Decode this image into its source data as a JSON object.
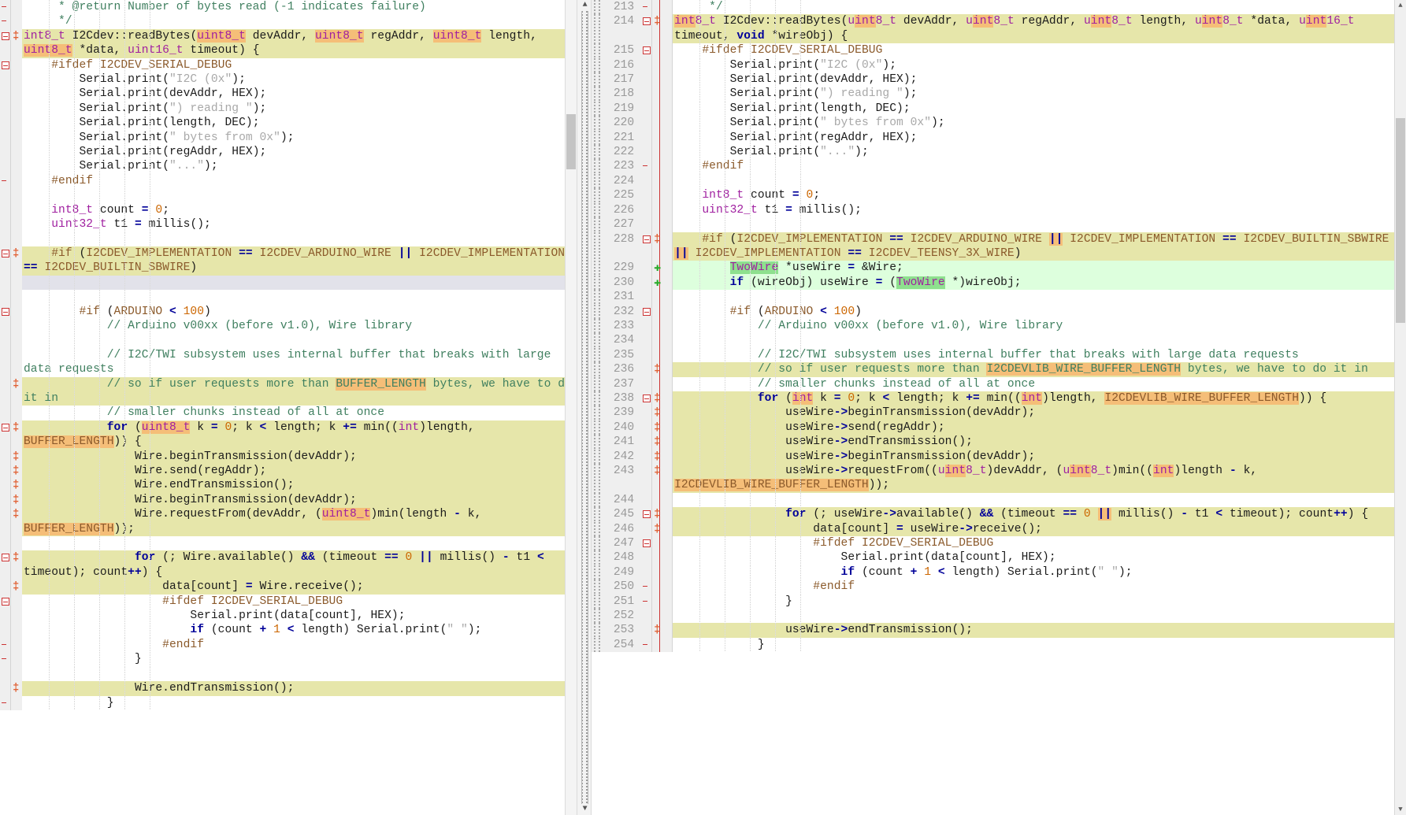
{
  "app": {
    "kind": "side-by-side-source-diff-viewer",
    "colors": {
      "changed_line_bg": "#e6e6aa",
      "added_line_bg": "#ddffdd",
      "inline_change_hl": "#f5be78",
      "inline_add_hl": "#8ee08e",
      "gap_fill_bg": "#e2e2ea",
      "gutter_bg": "#efefef",
      "change_marker": "#e05a2b",
      "add_marker": "#2aaa2a",
      "fold_marker": "#cc3333",
      "linenum_text": "#999999",
      "comment": "#3f7f5f",
      "keyword": "#000099",
      "type": "#a020a0",
      "string": "#a8a8a8",
      "number": "#cc6600",
      "preprocessor": "#8b5a2b"
    }
  },
  "left_pane": {
    "name": "original-version",
    "has_vertical_scrollbar": true,
    "lines": [
      {
        "id": "L000",
        "state": "none",
        "marker": "",
        "fold": "end",
        "text": "     * @return Number of bytes read (-1 indicates failure)"
      },
      {
        "id": "L001",
        "state": "none",
        "marker": "",
        "fold": "end",
        "text": "     */"
      },
      {
        "id": "L002",
        "state": "changed",
        "marker": "change",
        "fold": "start",
        "text": "int8_t I2Cdev::readBytes(uint8_t devAddr, uint8_t regAddr, uint8_t length, uint8_t *data, uint16_t timeout) {"
      },
      {
        "id": "L003",
        "state": "none",
        "marker": "",
        "fold": "start",
        "text": "    #ifdef I2CDEV_SERIAL_DEBUG"
      },
      {
        "id": "L004",
        "state": "none",
        "marker": "",
        "fold": "",
        "text": "        Serial.print(\"I2C (0x\");"
      },
      {
        "id": "L005",
        "state": "none",
        "marker": "",
        "fold": "",
        "text": "        Serial.print(devAddr, HEX);"
      },
      {
        "id": "L006",
        "state": "none",
        "marker": "",
        "fold": "",
        "text": "        Serial.print(\") reading \");"
      },
      {
        "id": "L007",
        "state": "none",
        "marker": "",
        "fold": "",
        "text": "        Serial.print(length, DEC);"
      },
      {
        "id": "L008",
        "state": "none",
        "marker": "",
        "fold": "",
        "text": "        Serial.print(\" bytes from 0x\");"
      },
      {
        "id": "L009",
        "state": "none",
        "marker": "",
        "fold": "",
        "text": "        Serial.print(regAddr, HEX);"
      },
      {
        "id": "L010",
        "state": "none",
        "marker": "",
        "fold": "",
        "text": "        Serial.print(\"...\");"
      },
      {
        "id": "L011",
        "state": "none",
        "marker": "",
        "fold": "end",
        "text": "    #endif"
      },
      {
        "id": "L012",
        "state": "none",
        "marker": "",
        "fold": "",
        "text": ""
      },
      {
        "id": "L013",
        "state": "none",
        "marker": "",
        "fold": "",
        "text": "    int8_t count = 0;"
      },
      {
        "id": "L014",
        "state": "none",
        "marker": "",
        "fold": "",
        "text": "    uint32_t t1 = millis();"
      },
      {
        "id": "L015",
        "state": "none",
        "marker": "",
        "fold": "",
        "text": ""
      },
      {
        "id": "L016",
        "state": "changed",
        "marker": "change",
        "fold": "start",
        "text": "    #if (I2CDEV_IMPLEMENTATION == I2CDEV_ARDUINO_WIRE || I2CDEV_IMPLEMENTATION == I2CDEV_BUILTIN_SBWIRE)"
      },
      {
        "id": "L017",
        "state": "gapfill",
        "marker": "",
        "fold": "",
        "text": ""
      },
      {
        "id": "L018",
        "state": "none",
        "marker": "",
        "fold": "",
        "text": ""
      },
      {
        "id": "L019",
        "state": "none",
        "marker": "",
        "fold": "start",
        "text": "        #if (ARDUINO < 100)"
      },
      {
        "id": "L020",
        "state": "none",
        "marker": "",
        "fold": "",
        "text": "            // Arduino v00xx (before v1.0), Wire library"
      },
      {
        "id": "L021",
        "state": "none",
        "marker": "",
        "fold": "",
        "text": ""
      },
      {
        "id": "L022",
        "state": "none",
        "marker": "",
        "fold": "",
        "text": "            // I2C/TWI subsystem uses internal buffer that breaks with large data requests"
      },
      {
        "id": "L023",
        "state": "changed",
        "marker": "change",
        "fold": "",
        "text": "            // so if user requests more than BUFFER_LENGTH bytes, we have to do it in"
      },
      {
        "id": "L024",
        "state": "none",
        "marker": "",
        "fold": "",
        "text": "            // smaller chunks instead of all at once"
      },
      {
        "id": "L025",
        "state": "changed",
        "marker": "change",
        "fold": "start",
        "text": "            for (uint8_t k = 0; k < length; k += min((int)length, BUFFER_LENGTH)) {"
      },
      {
        "id": "L026",
        "state": "changed",
        "marker": "change",
        "fold": "",
        "text": "                Wire.beginTransmission(devAddr);"
      },
      {
        "id": "L027",
        "state": "changed",
        "marker": "change",
        "fold": "",
        "text": "                Wire.send(regAddr);"
      },
      {
        "id": "L028",
        "state": "changed",
        "marker": "change",
        "fold": "",
        "text": "                Wire.endTransmission();"
      },
      {
        "id": "L029",
        "state": "changed",
        "marker": "change",
        "fold": "",
        "text": "                Wire.beginTransmission(devAddr);"
      },
      {
        "id": "L030",
        "state": "changed",
        "marker": "change",
        "fold": "",
        "text": "                Wire.requestFrom(devAddr, (uint8_t)min(length - k, BUFFER_LENGTH));"
      },
      {
        "id": "L031",
        "state": "none",
        "marker": "",
        "fold": "",
        "text": ""
      },
      {
        "id": "L032",
        "state": "changed",
        "marker": "change",
        "fold": "start",
        "text": "                for (; Wire.available() && (timeout == 0 || millis() - t1 < timeout); count++) {"
      },
      {
        "id": "L033",
        "state": "changed",
        "marker": "change",
        "fold": "",
        "text": "                    data[count] = Wire.receive();"
      },
      {
        "id": "L034",
        "state": "none",
        "marker": "",
        "fold": "start",
        "text": "                    #ifdef I2CDEV_SERIAL_DEBUG"
      },
      {
        "id": "L035",
        "state": "none",
        "marker": "",
        "fold": "",
        "text": "                        Serial.print(data[count], HEX);"
      },
      {
        "id": "L036",
        "state": "none",
        "marker": "",
        "fold": "",
        "text": "                        if (count + 1 < length) Serial.print(\" \");"
      },
      {
        "id": "L037",
        "state": "none",
        "marker": "",
        "fold": "end",
        "text": "                    #endif"
      },
      {
        "id": "L038",
        "state": "none",
        "marker": "",
        "fold": "end",
        "text": "                }"
      },
      {
        "id": "L039",
        "state": "none",
        "marker": "",
        "fold": "",
        "text": ""
      },
      {
        "id": "L040",
        "state": "changed",
        "marker": "change",
        "fold": "",
        "text": "                Wire.endTransmission();"
      },
      {
        "id": "L041",
        "state": "none",
        "marker": "",
        "fold": "end",
        "text": "            }"
      }
    ]
  },
  "right_pane": {
    "name": "modified-version",
    "has_vertical_scrollbar": true,
    "lines": [
      {
        "id": "R000",
        "num": "213",
        "state": "none",
        "marker": "",
        "fold": "end",
        "text": "     */"
      },
      {
        "id": "R001",
        "num": "214",
        "state": "changed",
        "marker": "change",
        "fold": "start",
        "text": "int8_t I2Cdev::readBytes(uint8_t devAddr, uint8_t regAddr, uint8_t length, uint8_t *data, uint16_t timeout, void *wireObj) {"
      },
      {
        "id": "R002",
        "num": "215",
        "state": "none",
        "marker": "",
        "fold": "start",
        "text": "    #ifdef I2CDEV_SERIAL_DEBUG"
      },
      {
        "id": "R003",
        "num": "216",
        "state": "none",
        "marker": "",
        "fold": "",
        "text": "        Serial.print(\"I2C (0x\");"
      },
      {
        "id": "R004",
        "num": "217",
        "state": "none",
        "marker": "",
        "fold": "",
        "text": "        Serial.print(devAddr, HEX);"
      },
      {
        "id": "R005",
        "num": "218",
        "state": "none",
        "marker": "",
        "fold": "",
        "text": "        Serial.print(\") reading \");"
      },
      {
        "id": "R006",
        "num": "219",
        "state": "none",
        "marker": "",
        "fold": "",
        "text": "        Serial.print(length, DEC);"
      },
      {
        "id": "R007",
        "num": "220",
        "state": "none",
        "marker": "",
        "fold": "",
        "text": "        Serial.print(\" bytes from 0x\");"
      },
      {
        "id": "R008",
        "num": "221",
        "state": "none",
        "marker": "",
        "fold": "",
        "text": "        Serial.print(regAddr, HEX);"
      },
      {
        "id": "R009",
        "num": "222",
        "state": "none",
        "marker": "",
        "fold": "",
        "text": "        Serial.print(\"...\");"
      },
      {
        "id": "R010",
        "num": "223",
        "state": "none",
        "marker": "",
        "fold": "end",
        "text": "    #endif"
      },
      {
        "id": "R011",
        "num": "224",
        "state": "none",
        "marker": "",
        "fold": "",
        "text": ""
      },
      {
        "id": "R012",
        "num": "225",
        "state": "none",
        "marker": "",
        "fold": "",
        "text": "    int8_t count = 0;"
      },
      {
        "id": "R013",
        "num": "226",
        "state": "none",
        "marker": "",
        "fold": "",
        "text": "    uint32_t t1 = millis();"
      },
      {
        "id": "R014",
        "num": "227",
        "state": "none",
        "marker": "",
        "fold": "",
        "text": ""
      },
      {
        "id": "R015",
        "num": "228",
        "state": "changed",
        "marker": "change",
        "fold": "start",
        "text": "    #if (I2CDEV_IMPLEMENTATION == I2CDEV_ARDUINO_WIRE || I2CDEV_IMPLEMENTATION == I2CDEV_BUILTIN_SBWIRE || I2CDEV_IMPLEMENTATION == I2CDEV_TEENSY_3X_WIRE)"
      },
      {
        "id": "R016",
        "num": "229",
        "state": "added",
        "marker": "add",
        "fold": "",
        "text": "        TwoWire *useWire = &Wire;"
      },
      {
        "id": "R017",
        "num": "230",
        "state": "added",
        "marker": "add",
        "fold": "",
        "text": "        if (wireObj) useWire = (TwoWire *)wireObj;"
      },
      {
        "id": "R018",
        "num": "231",
        "state": "none",
        "marker": "",
        "fold": "",
        "text": ""
      },
      {
        "id": "R019",
        "num": "232",
        "state": "none",
        "marker": "",
        "fold": "start",
        "text": "        #if (ARDUINO < 100)"
      },
      {
        "id": "R020",
        "num": "233",
        "state": "none",
        "marker": "",
        "fold": "",
        "text": "            // Arduino v00xx (before v1.0), Wire library"
      },
      {
        "id": "R021",
        "num": "234",
        "state": "none",
        "marker": "",
        "fold": "",
        "text": ""
      },
      {
        "id": "R022",
        "num": "235",
        "state": "none",
        "marker": "",
        "fold": "",
        "text": "            // I2C/TWI subsystem uses internal buffer that breaks with large data requests"
      },
      {
        "id": "R023",
        "num": "236",
        "state": "changed",
        "marker": "change",
        "fold": "",
        "text": "            // so if user requests more than I2CDEVLIB_WIRE_BUFFER_LENGTH bytes, we have to do it in"
      },
      {
        "id": "R024",
        "num": "237",
        "state": "none",
        "marker": "",
        "fold": "",
        "text": "            // smaller chunks instead of all at once"
      },
      {
        "id": "R025",
        "num": "238",
        "state": "changed",
        "marker": "change",
        "fold": "start",
        "text": "            for (int k = 0; k < length; k += min((int)length, I2CDEVLIB_WIRE_BUFFER_LENGTH)) {"
      },
      {
        "id": "R026",
        "num": "239",
        "state": "changed",
        "marker": "change",
        "fold": "",
        "text": "                useWire->beginTransmission(devAddr);"
      },
      {
        "id": "R027",
        "num": "240",
        "state": "changed",
        "marker": "change",
        "fold": "",
        "text": "                useWire->send(regAddr);"
      },
      {
        "id": "R028",
        "num": "241",
        "state": "changed",
        "marker": "change",
        "fold": "",
        "text": "                useWire->endTransmission();"
      },
      {
        "id": "R029",
        "num": "242",
        "state": "changed",
        "marker": "change",
        "fold": "",
        "text": "                useWire->beginTransmission(devAddr);"
      },
      {
        "id": "R030",
        "num": "243",
        "state": "changed",
        "marker": "change",
        "fold": "",
        "text": "                useWire->requestFrom((uint8_t)devAddr, (uint8_t)min((int)length - k, I2CDEVLIB_WIRE_BUFFER_LENGTH));"
      },
      {
        "id": "R031",
        "num": "244",
        "state": "none",
        "marker": "",
        "fold": "",
        "text": ""
      },
      {
        "id": "R032",
        "num": "245",
        "state": "changed",
        "marker": "change",
        "fold": "start",
        "text": "                for (; useWire->available() && (timeout == 0 || millis() - t1 < timeout); count++) {"
      },
      {
        "id": "R033",
        "num": "246",
        "state": "changed",
        "marker": "change",
        "fold": "",
        "text": "                    data[count] = useWire->receive();"
      },
      {
        "id": "R034",
        "num": "247",
        "state": "none",
        "marker": "",
        "fold": "start",
        "text": "                    #ifdef I2CDEV_SERIAL_DEBUG"
      },
      {
        "id": "R035",
        "num": "248",
        "state": "none",
        "marker": "",
        "fold": "",
        "text": "                        Serial.print(data[count], HEX);"
      },
      {
        "id": "R036",
        "num": "249",
        "state": "none",
        "marker": "",
        "fold": "",
        "text": "                        if (count + 1 < length) Serial.print(\" \");"
      },
      {
        "id": "R037",
        "num": "250",
        "state": "none",
        "marker": "",
        "fold": "end",
        "text": "                    #endif"
      },
      {
        "id": "R038",
        "num": "251",
        "state": "none",
        "marker": "",
        "fold": "end",
        "text": "                }"
      },
      {
        "id": "R039",
        "num": "252",
        "state": "none",
        "marker": "",
        "fold": "",
        "text": ""
      },
      {
        "id": "R040",
        "num": "253",
        "state": "changed",
        "marker": "change",
        "fold": "",
        "text": "                useWire->endTransmission();"
      },
      {
        "id": "R041",
        "num": "254",
        "state": "none",
        "marker": "",
        "fold": "end",
        "text": "            }"
      }
    ]
  },
  "scrollbar": {
    "up_arrow": "▲",
    "down_arrow": "▼"
  }
}
